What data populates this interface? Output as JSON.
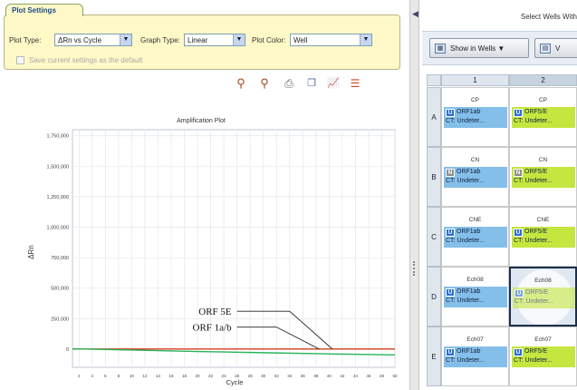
{
  "settings": {
    "tab_label": "Plot Settings",
    "plot_type_label": "Plot Type:",
    "plot_type_value": "ΔRn vs Cycle",
    "graph_type_label": "Graph Type:",
    "graph_type_value": "Linear",
    "plot_color_label": "Plot Color:",
    "plot_color_value": "Well",
    "save_default_label": "Save current settings as the default"
  },
  "toolbar_icons": [
    "zoom-in-icon",
    "zoom-out-icon",
    "print-icon",
    "copy-icon",
    "chart-icon",
    "list-icon"
  ],
  "right_panel": {
    "title": "Select Wells With",
    "show_in_wells_label": "Show in Wells ▼",
    "view_button_label": "V"
  },
  "plate": {
    "columns": [
      "1",
      "2"
    ],
    "rows": [
      {
        "label": "A",
        "wells": [
          {
            "name": "CP",
            "targets": [
              {
                "badge": "U",
                "name": "ORF1ab",
                "ct": "CT: Undeter..."
              }
            ]
          },
          {
            "name": "CP",
            "targets": [
              {
                "badge": "U",
                "name": "ORF5/E",
                "ct": "CT: Undeter..."
              }
            ]
          }
        ]
      },
      {
        "label": "B",
        "wells": [
          {
            "name": "CN",
            "targets": [
              {
                "badge": "N",
                "name": "ORF1ab",
                "ct": "CT: Undeter..."
              }
            ]
          },
          {
            "name": "CN",
            "targets": [
              {
                "badge": "N",
                "name": "ORF5/E",
                "ct": "CT: Undeter..."
              }
            ]
          }
        ]
      },
      {
        "label": "C",
        "wells": [
          {
            "name": "CNE",
            "targets": [
              {
                "badge": "U",
                "name": "ORF1ab",
                "ct": "CT: Undeter..."
              }
            ]
          },
          {
            "name": "CNE",
            "targets": [
              {
                "badge": "U",
                "name": "ORF5/E",
                "ct": "CT: Undeter..."
              }
            ]
          }
        ]
      },
      {
        "label": "D",
        "wells": [
          {
            "name": "Ech08",
            "targets": [
              {
                "badge": "U",
                "name": "ORF1ab",
                "ct": "CT: Undeter..."
              }
            ]
          },
          {
            "name": "Ech08",
            "selected": true,
            "targets": [
              {
                "badge": "U",
                "name": "ORF5/E",
                "ct": "CT: Undeter..."
              }
            ]
          }
        ]
      },
      {
        "label": "E",
        "wells": [
          {
            "name": "Ech07",
            "targets": [
              {
                "badge": "U",
                "name": "ORF1ab",
                "ct": "CT: Undeter..."
              }
            ]
          },
          {
            "name": "Ech07",
            "targets": [
              {
                "badge": "U",
                "name": "ORF5/E",
                "ct": "CT: Undeter..."
              }
            ]
          }
        ]
      }
    ]
  },
  "chart_data": {
    "type": "line",
    "title": "Amplification Plot",
    "xlabel": "Cycle",
    "ylabel": "ΔRn",
    "xlim": [
      1,
      50
    ],
    "ylim": [
      -150000,
      1800000
    ],
    "x_ticks": [
      2,
      4,
      6,
      8,
      10,
      12,
      14,
      16,
      18,
      20,
      22,
      24,
      26,
      28,
      30,
      32,
      34,
      36,
      38,
      40,
      42,
      44,
      46,
      48,
      50
    ],
    "y_ticks": [
      0,
      250000,
      500000,
      750000,
      1000000,
      1250000,
      1500000,
      1750000
    ],
    "y_tick_labels": [
      "0",
      "250,000",
      "500,000",
      "750,000",
      "1,000,000",
      "1,250,000",
      "1,500,000",
      "1,750,000"
    ],
    "grid": true,
    "series": [
      {
        "color": "#d43b20",
        "x": [
          1,
          10,
          20,
          30,
          40,
          50
        ],
        "y": [
          0,
          0,
          0,
          0,
          0,
          0
        ]
      },
      {
        "color": "#29b35a",
        "x": [
          1,
          10,
          20,
          30,
          40,
          50
        ],
        "y": [
          2000,
          -8000,
          -20000,
          -30000,
          -40000,
          -48000
        ]
      }
    ],
    "annotations": [
      {
        "text": "ORF 5E",
        "x1": 26,
        "y1": 310000,
        "x2": 34,
        "y2": 310000,
        "x3": 40.5,
        "y3": 0
      },
      {
        "text": "ORF 1a/b",
        "x1": 26,
        "y1": 180000,
        "x2": 32,
        "y2": 180000,
        "x3": 38.5,
        "y3": 0
      }
    ]
  }
}
